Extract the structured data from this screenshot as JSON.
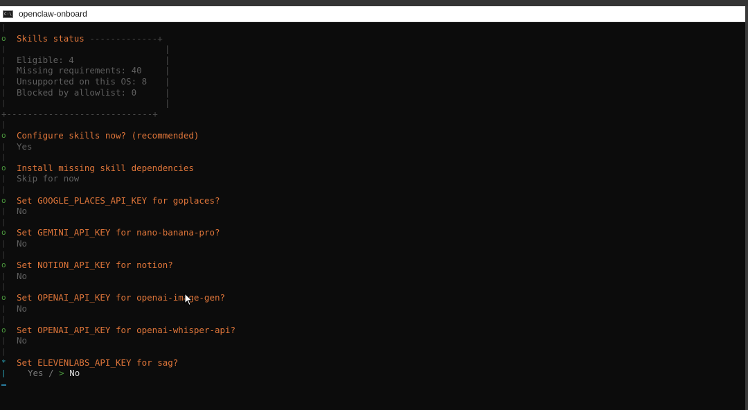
{
  "window": {
    "title": "openclaw-onboard",
    "icon": "terminal-icon"
  },
  "skills_box": {
    "header": "Skills status",
    "rule": "-------------+",
    "bottom_rule": "+----------------------------+",
    "lines": [
      "Eligible: 4",
      "Missing requirements: 40",
      "Unsupported on this OS: 8",
      "Blocked by allowlist: 0"
    ]
  },
  "prompts": [
    {
      "question": "Configure skills now? (recommended)",
      "answer": "Yes"
    },
    {
      "question": "Install missing skill dependencies",
      "answer": "Skip for now"
    },
    {
      "question": "Set GOOGLE_PLACES_API_KEY for goplaces?",
      "answer": "No"
    },
    {
      "question": "Set GEMINI_API_KEY for nano-banana-pro?",
      "answer": "No"
    },
    {
      "question": "Set NOTION_API_KEY for notion?",
      "answer": "No"
    },
    {
      "question": "Set OPENAI_API_KEY for openai-image-gen?",
      "answer": "No"
    },
    {
      "question": "Set OPENAI_API_KEY for openai-whisper-api?",
      "answer": "No"
    }
  ],
  "active_prompt": {
    "question": "Set ELEVENLABS_API_KEY for sag?",
    "option_yes": "Yes",
    "option_sep": " / ",
    "pointer": ">",
    "option_no": "No"
  },
  "glyphs": {
    "bar": "|",
    "step": "o",
    "active": "*",
    "plus": "+"
  },
  "colors": {
    "prompt": "#e0763a",
    "answer": "#5f5f5f",
    "step_marker": "#4c9a3e",
    "active_marker": "#2aa1b3",
    "background": "#0c0c0c"
  }
}
